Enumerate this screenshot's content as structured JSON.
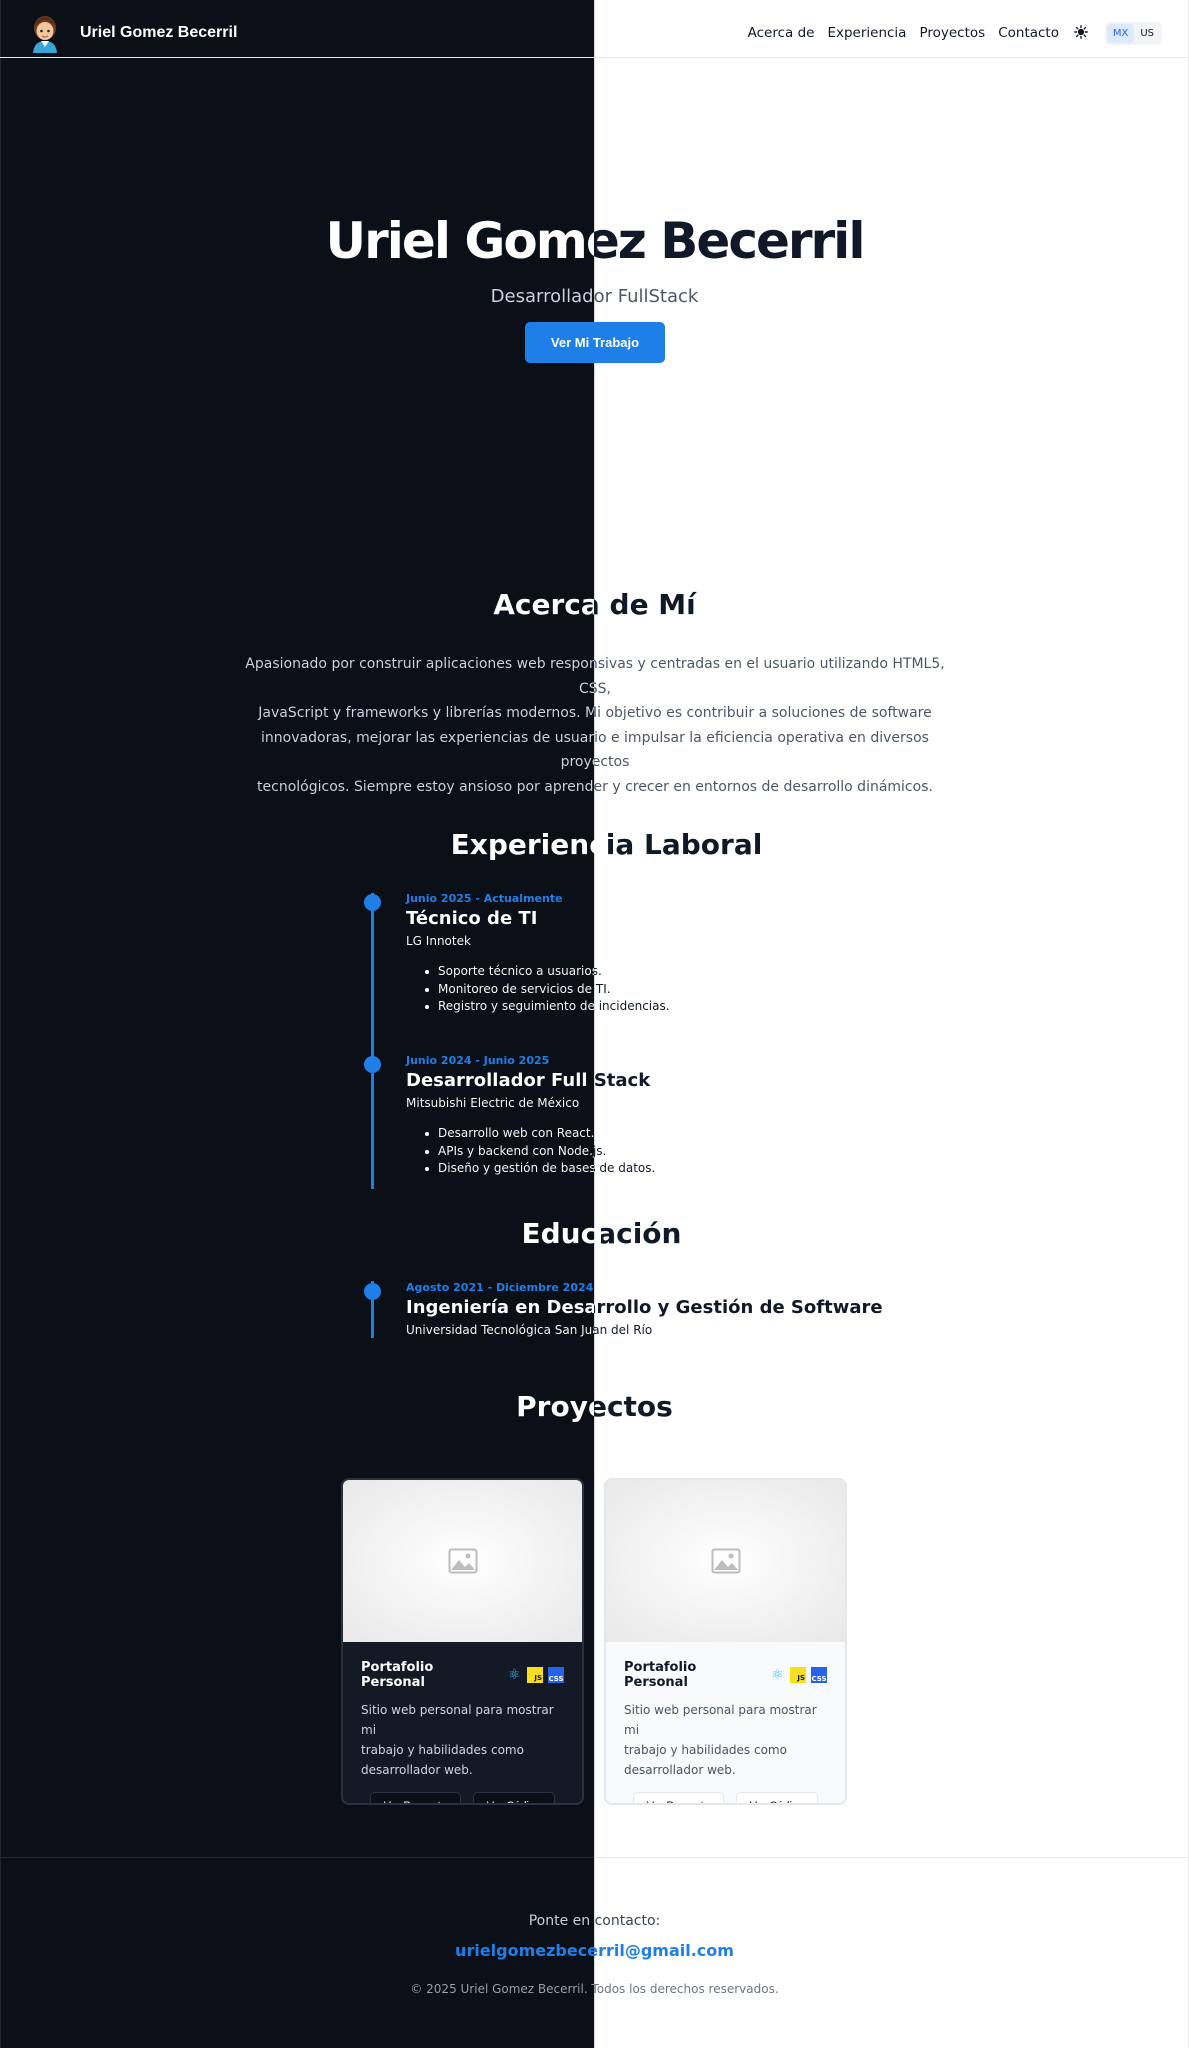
{
  "header": {
    "brand": "Uriel Gomez Becerril",
    "nav": [
      "Acerca de",
      "Experiencia",
      "Proyectos",
      "Contacto"
    ],
    "theme_icon": "sun-icon",
    "languages": [
      "MX",
      "US"
    ],
    "active_language": "MX"
  },
  "hero": {
    "title": "Uriel Gomez Becerril",
    "subtitle": "Desarrollador FullStack",
    "cta": "Ver Mi Trabajo"
  },
  "about": {
    "title": "Acerca de Mí",
    "lines": [
      "Apasionado por construir aplicaciones web responsivas y centradas en el usuario utilizando HTML5, CSS,",
      "JavaScript y frameworks y librerías modernos. Mi objetivo es contribuir a soluciones de software",
      "innovadoras, mejorar las experiencias de usuario e impulsar la eficiencia operativa en diversos proyectos",
      "tecnológicos. Siempre estoy ansioso por aprender y crecer en entornos de desarrollo dinámicos."
    ]
  },
  "experience": {
    "title": "Experiencia Laboral",
    "items": [
      {
        "date": "Junio 2025 - Actualmente",
        "role": "Técnico de TI",
        "company": "LG Innotek",
        "bullets": [
          "Soporte técnico a usuarios.",
          "Monitoreo de servicios de TI.",
          "Registro y seguimiento de incidencias."
        ]
      },
      {
        "date": "Junio 2024 - Junio 2025",
        "role": "Desarrollador Full Stack",
        "company": "Mitsubishi Electric de México",
        "bullets": [
          "Desarrollo web con React.",
          "APIs y backend con Node.js.",
          "Diseño y gestión de bases de datos."
        ]
      }
    ]
  },
  "education": {
    "title": "Educación",
    "items": [
      {
        "date": "Agosto 2021 - Diciembre 2024",
        "degree": "Ingeniería en Desarrollo y Gestión de Software",
        "school": "Universidad Tecnológica San Juan del Río"
      }
    ]
  },
  "projects": {
    "title": "Proyectos",
    "cards": [
      {
        "title": "Portafolio Personal",
        "tech_icons": [
          "react-icon",
          "js-icon",
          "css-icon"
        ],
        "tech_labels": [
          "JS",
          "CSS"
        ],
        "desc_lines": [
          "Sitio web personal para mostrar mi",
          "trabajo y habilidades como",
          "desarrollador web."
        ],
        "btn_view": "Ver Proyecto",
        "btn_code": "Ver Código"
      },
      {
        "title": "Portafolio Personal",
        "tech_icons": [
          "react-icon",
          "js-icon",
          "css-icon"
        ],
        "tech_labels": [
          "JS",
          "CSS"
        ],
        "desc_lines": [
          "Sitio web personal para mostrar mi",
          "trabajo y habilidades como",
          "desarrollador web."
        ],
        "btn_view": "Ver Proyecto",
        "btn_code": "Ver Código"
      }
    ]
  },
  "footer": {
    "label": "Ponte en contacto:",
    "email": "urielgomezbecerril@gmail.com",
    "copyright": "© 2025 Uriel Gomez Becerril. Todos los derechos reservados."
  },
  "colors": {
    "dark_bg": "#0b0f17",
    "light_bg": "#ffffff",
    "accent": "#1e7fe8"
  }
}
